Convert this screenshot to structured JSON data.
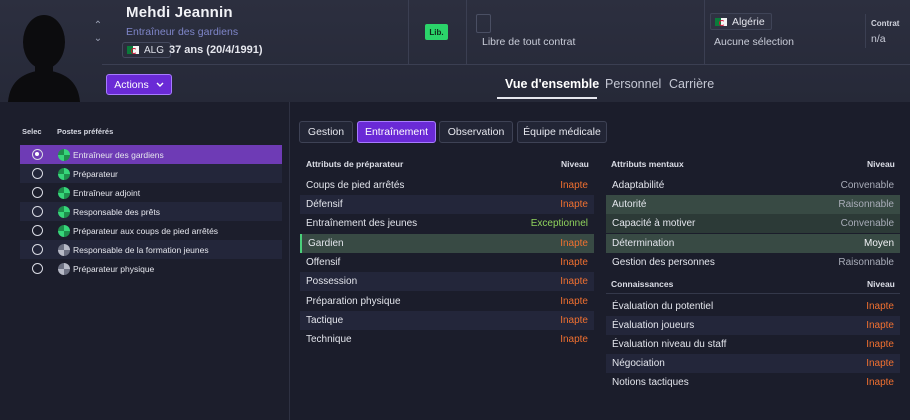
{
  "header": {
    "name": "Mehdi Jeannin",
    "role": "Entraîneur des gardiens",
    "nationality_code": "ALG",
    "age": "37 ans (20/4/1991)",
    "status_badge": "Lib.",
    "contract_status": "Libre de tout contrat",
    "country": "Algérie",
    "selection": "Aucune sélection",
    "contract_label": "Contrat",
    "contract_value": "n/a",
    "actions_label": "Actions",
    "tabs": [
      "Vue d'ensemble",
      "Personnel",
      "Carrière"
    ],
    "active_tab": "Vue d'ensemble"
  },
  "left_panel": {
    "col_select": "Selec",
    "col_roles": "Postes préférés",
    "roles": [
      {
        "label": "Entraîneur des gardiens",
        "selected": true,
        "icon": "green-role-icon"
      },
      {
        "label": "Préparateur",
        "selected": false,
        "icon": "green-role-icon"
      },
      {
        "label": "Entraîneur adjoint",
        "selected": false,
        "icon": "green-role-icon"
      },
      {
        "label": "Responsable des prêts",
        "selected": false,
        "icon": "green-role-icon"
      },
      {
        "label": "Préparateur aux coups de pied arrêtés",
        "selected": false,
        "icon": "green-role-icon"
      },
      {
        "label": "Responsable de la formation jeunes",
        "selected": false,
        "icon": "gray-role-icon"
      },
      {
        "label": "Préparateur physique",
        "selected": false,
        "icon": "gray-role-icon"
      }
    ]
  },
  "sub_tabs": [
    "Gestion",
    "Entraînement",
    "Observation",
    "Équipe médicale"
  ],
  "active_sub_tab": "Entraînement",
  "coach_attributes": {
    "title": "Attributs de préparateur",
    "level_header": "Niveau",
    "rows": [
      {
        "name": "Coups de pied arrêtés",
        "level": "Inapte"
      },
      {
        "name": "Défensif",
        "level": "Inapte"
      },
      {
        "name": "Entraînement des jeunes",
        "level": "Exceptionnel"
      },
      {
        "name": "Gardien",
        "level": "Inapte"
      },
      {
        "name": "Offensif",
        "level": "Inapte"
      },
      {
        "name": "Possession",
        "level": "Inapte"
      },
      {
        "name": "Préparation physique",
        "level": "Inapte"
      },
      {
        "name": "Tactique",
        "level": "Inapte"
      },
      {
        "name": "Technique",
        "level": "Inapte"
      }
    ]
  },
  "mental_attributes": {
    "title": "Attributs mentaux",
    "level_header": "Niveau",
    "rows": [
      {
        "name": "Adaptabilité",
        "level": "Convenable"
      },
      {
        "name": "Autorité",
        "level": "Raisonnable"
      },
      {
        "name": "Capacité à motiver",
        "level": "Convenable"
      },
      {
        "name": "Détermination",
        "level": "Moyen"
      },
      {
        "name": "Gestion des personnes",
        "level": "Raisonnable"
      }
    ]
  },
  "knowledge": {
    "title": "Connaissances",
    "level_header": "Niveau",
    "rows": [
      {
        "name": "Évaluation du potentiel",
        "level": "Inapte"
      },
      {
        "name": "Évaluation joueurs",
        "level": "Inapte"
      },
      {
        "name": "Évaluation niveau du staff",
        "level": "Inapte"
      },
      {
        "name": "Négociation",
        "level": "Inapte"
      },
      {
        "name": "Notions tactiques",
        "level": "Inapte"
      }
    ]
  },
  "colors": {
    "accent_purple": "#6a2ad6",
    "inapte": "#f07030",
    "exceptionnel": "#8fd35d",
    "lib_badge": "#2bd46a"
  }
}
